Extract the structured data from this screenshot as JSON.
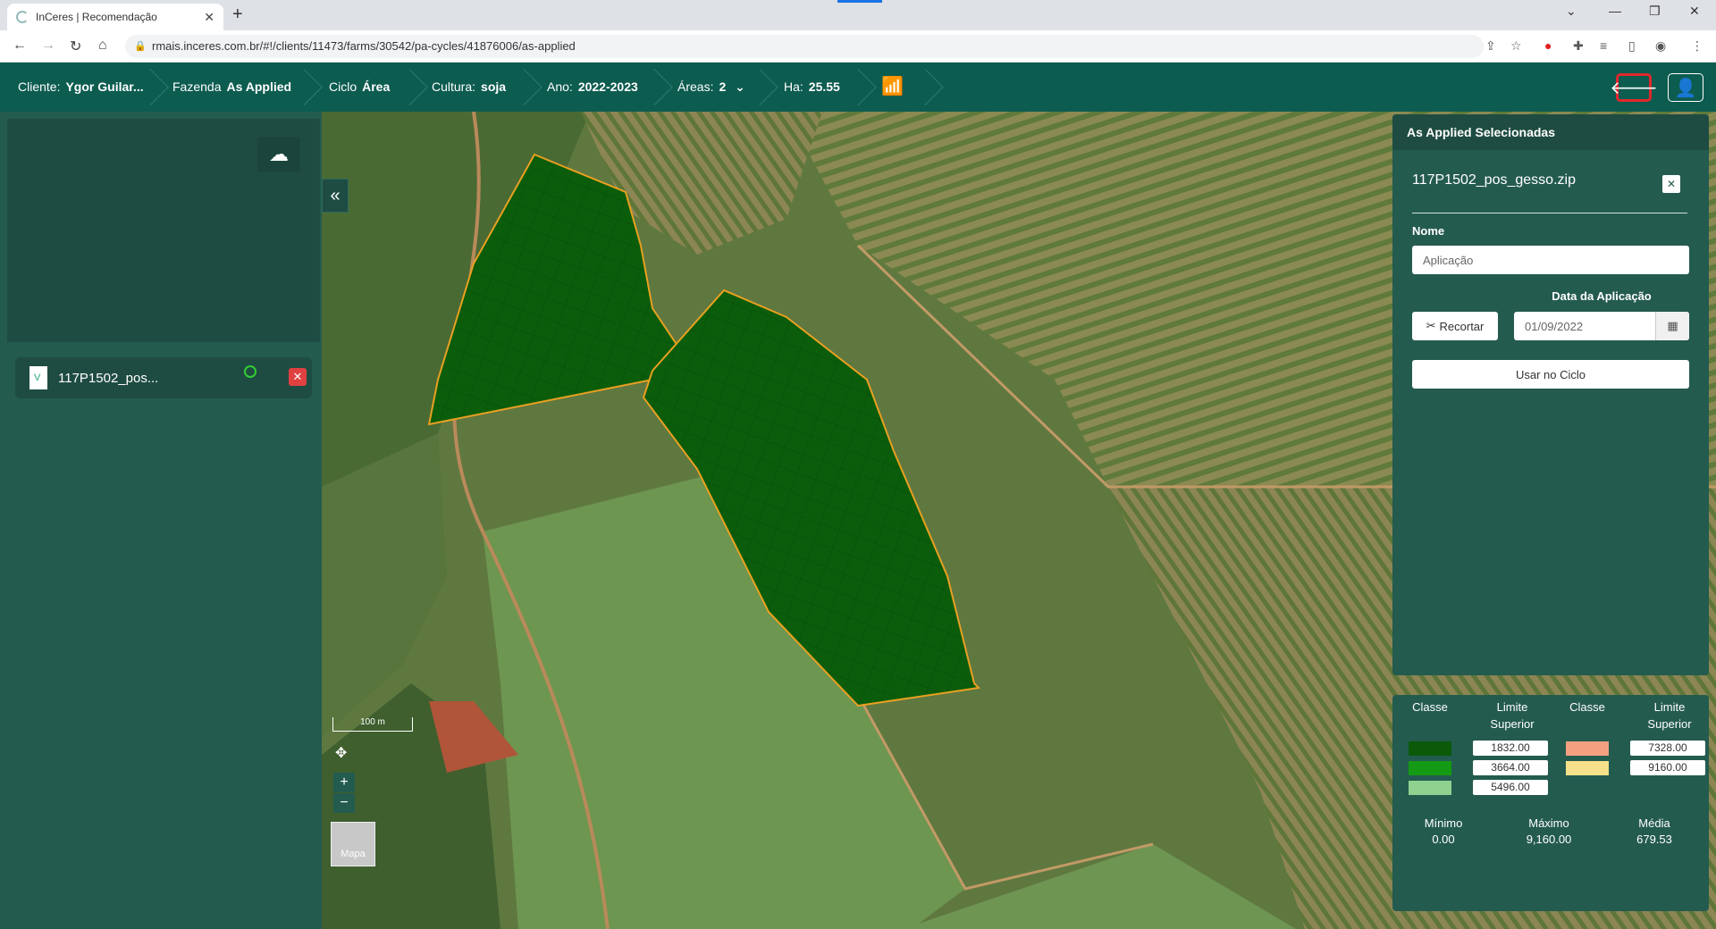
{
  "browser": {
    "tab_title": "InCeres | Recomendação",
    "url": "rmais.inceres.com.br/#!/clients/11473/farms/30542/pa-cycles/41876006/as-applied"
  },
  "header": {
    "cliente_label": "Cliente:",
    "cliente_value": "Ygor Guilar...",
    "fazenda_label": "Fazenda",
    "fazenda_value": "As Applied",
    "ciclo_label": "Ciclo",
    "ciclo_value": "Área",
    "cultura_label": "Cultura:",
    "cultura_value": "soja",
    "ano_label": "Ano:",
    "ano_value": "2022-2023",
    "areas_label": "Áreas:",
    "areas_value": "2",
    "ha_label": "Ha:",
    "ha_value": "25.55"
  },
  "left_panel": {
    "file_name": "117P1502_pos..."
  },
  "map": {
    "scale_label": "100 m",
    "zoom_in": "+",
    "zoom_out": "−",
    "map_type": "Mapa"
  },
  "right_panel": {
    "title": "As Applied Selecionadas",
    "file_name": "117P1502_pos_gesso.zip",
    "nome_label": "Nome",
    "nome_value": "Aplicação",
    "data_label": "Data da Aplicação",
    "data_value": "01/09/2022",
    "recortar_label": "Recortar",
    "usar_label": "Usar no Ciclo"
  },
  "legend": {
    "classe_header": "Classe",
    "limite_header_1": "Limite",
    "limite_header_2": "Superior",
    "classes_left": [
      {
        "color": "#0a5a0a",
        "value": "1832.00"
      },
      {
        "color": "#149a14",
        "value": "3664.00"
      },
      {
        "color": "#8fd18f",
        "value": "5496.00"
      }
    ],
    "classes_right": [
      {
        "color": "#f4a080",
        "value": "7328.00"
      },
      {
        "color": "#f6e08a",
        "value": "9160.00"
      }
    ],
    "minimo_label": "Mínimo",
    "minimo_value": "0.00",
    "maximo_label": "Máximo",
    "maximo_value": "9,160.00",
    "media_label": "Média",
    "media_value": "679.53"
  }
}
